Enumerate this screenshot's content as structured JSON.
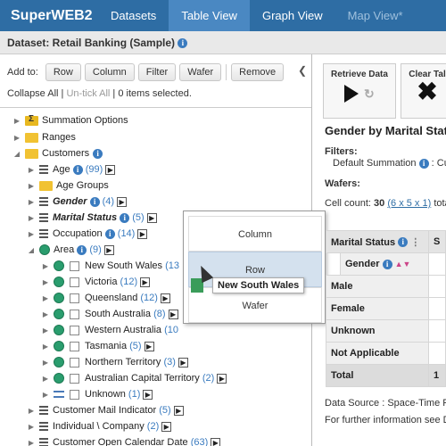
{
  "nav": {
    "brand": "SuperWEB2",
    "tabs": [
      "Datasets",
      "Table View",
      "Graph View",
      "Map View*"
    ]
  },
  "dataset": {
    "label": "Dataset: Retail Banking (Sample)"
  },
  "toolbar": {
    "add_to": "Add to:",
    "row": "Row",
    "column": "Column",
    "filter": "Filter",
    "wafer": "Wafer",
    "remove": "Remove"
  },
  "selection": {
    "collapse_all": "Collapse All",
    "untick_all": "Un-tick All",
    "selected": "0 items selected."
  },
  "tree": {
    "summation_options": "Summation Options",
    "ranges": "Ranges",
    "customers": "Customers",
    "age": "Age",
    "age_count": "(99)",
    "age_groups": "Age Groups",
    "gender": "Gender",
    "gender_count": "(4)",
    "marital_status": "Marital Status",
    "marital_count": "(5)",
    "occupation": "Occupation",
    "occupation_count": "(14)",
    "area": "Area",
    "area_count": "(9)",
    "nsw": "New South Wales",
    "nsw_count": "(13",
    "vic": "Victoria",
    "vic_count": "(12)",
    "qld": "Queensland",
    "qld_count": "(12)",
    "sa": "South Australia",
    "sa_count": "(8)",
    "wa": "Western Australia",
    "wa_count": "(10",
    "tas": "Tasmania",
    "tas_count": "(5)",
    "nt": "Northern Territory",
    "nt_count": "(3)",
    "act": "Australian Capital Territory",
    "act_count": "(2)",
    "unknown": "Unknown",
    "unknown_count": "(1)",
    "mail": "Customer Mail Indicator",
    "mail_count": "(5)",
    "individual": "Individual \\ Company",
    "individual_count": "(2)",
    "open_date": "Customer Open Calendar Date",
    "open_date_count": "(63)"
  },
  "popup": {
    "column": "Column",
    "row": "Row",
    "wafer": "Wafer",
    "drag_label": "New South Wales"
  },
  "actions": {
    "retrieve": "Retrieve Data",
    "clear": "Clear Tal"
  },
  "table_view": {
    "title": "Gender by Marital Statu",
    "filters_label": "Filters:",
    "filter_value_prefix": "Default Summation",
    "filter_value_suffix": ": Cu",
    "wafers_label": "Wafers:",
    "cell_count_prefix": "Cell count:",
    "cell_count": "30",
    "cell_dims": "(6 x 5 x 1)",
    "cell_count_suffix": "tota",
    "col_header": "Marital Status",
    "col_s": "S",
    "row_header": "Gender",
    "rows": [
      "Male",
      "Female",
      "Unknown",
      "Not Applicable"
    ],
    "total": "Total",
    "total_val": "1",
    "source": "Data Source : Space-Time F",
    "more_info": "For further information see D"
  }
}
